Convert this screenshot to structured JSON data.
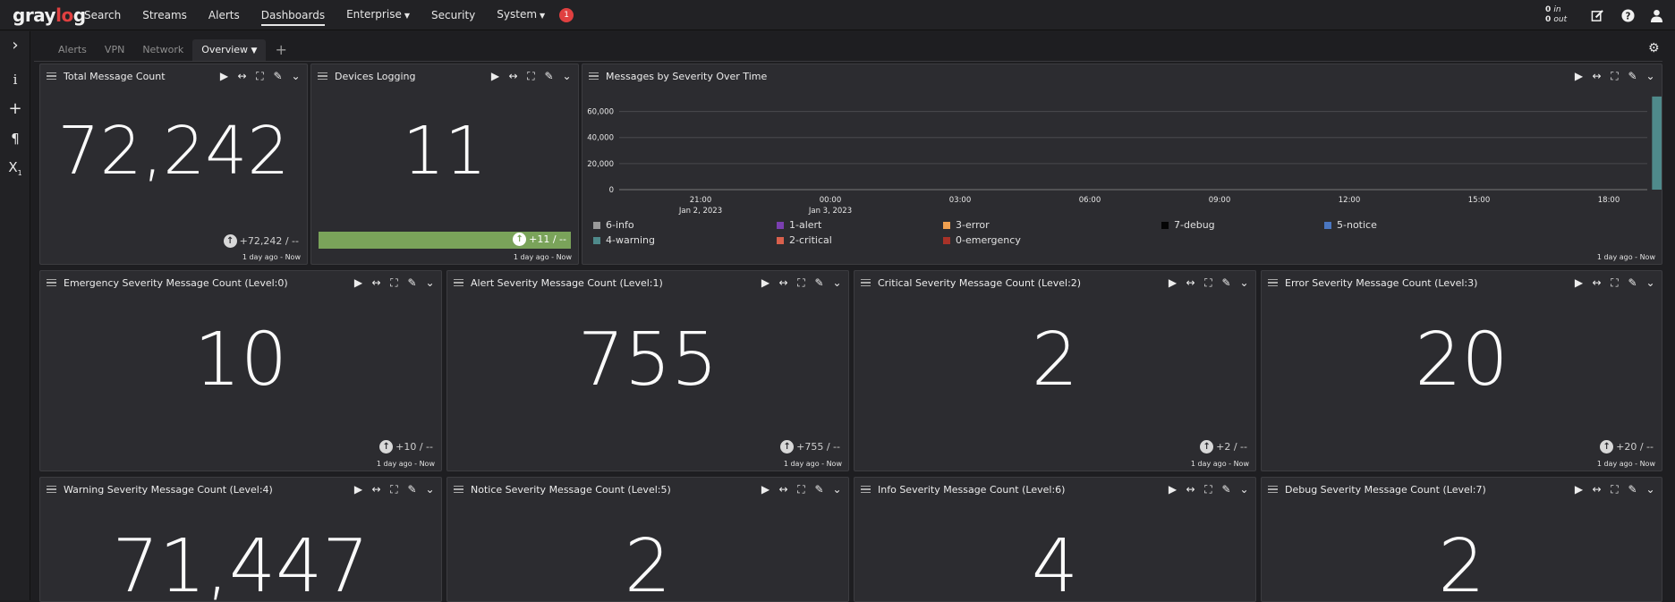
{
  "nav": {
    "logo_pre": "gray",
    "logo_mid": "lo",
    "logo_post": "g",
    "items": [
      "Search",
      "Streams",
      "Alerts",
      "Dashboards",
      "Enterprise",
      "Security",
      "System"
    ],
    "notification_count": "1",
    "throughput_in_value": "0",
    "throughput_in_label": "in",
    "throughput_out_value": "0",
    "throughput_out_label": "out"
  },
  "tabs": [
    "Alerts",
    "VPN",
    "Network",
    "Overview",
    "+"
  ],
  "sidebar_icons": [
    "chevron-right-icon",
    "info-icon",
    "plus-icon",
    "paragraph-icon",
    "subscript-icon"
  ],
  "widgets": {
    "total": {
      "title": "Total Message Count",
      "value": "72,242",
      "delta": "+72,242 / --",
      "stamp": "1 day ago - Now"
    },
    "devices": {
      "title": "Devices Logging",
      "value": "11",
      "delta": "+11 / --",
      "stamp": "1 day ago - Now"
    },
    "chart": {
      "title": "Messages by Severity Over Time",
      "stamp": "1 day ago - Now"
    },
    "emergency": {
      "title": "Emergency Severity Message Count (Level:0)",
      "value": "10",
      "delta": "+10 / --",
      "stamp": "1 day ago - Now"
    },
    "alert": {
      "title": "Alert Severity Message Count (Level:1)",
      "value": "755",
      "delta": "+755 / --",
      "stamp": "1 day ago - Now"
    },
    "critical": {
      "title": "Critical Severity Message Count (Level:2)",
      "value": "2",
      "delta": "+2 / --",
      "stamp": "1 day ago - Now"
    },
    "error": {
      "title": "Error Severity Message Count (Level:3)",
      "value": "20",
      "delta": "+20 / --",
      "stamp": "1 day ago - Now"
    },
    "warning": {
      "title": "Warning Severity Message Count (Level:4)",
      "value": "71,447"
    },
    "notice": {
      "title": "Notice Severity Message Count (Level:5)",
      "value": "2"
    },
    "info": {
      "title": "Info Severity Message Count (Level:6)",
      "value": "4"
    },
    "debug": {
      "title": "Debug Severity Message Count (Level:7)",
      "value": "2"
    }
  },
  "chart_data": {
    "type": "bar",
    "y_ticks": [
      "60,000",
      "40,000",
      "20,000",
      "0"
    ],
    "ylim": [
      0,
      70000
    ],
    "x_ticks": [
      {
        "label": "21:00",
        "sub": "Jan 2, 2023"
      },
      {
        "label": "00:00",
        "sub": "Jan 3, 2023"
      },
      {
        "label": "03:00",
        "sub": ""
      },
      {
        "label": "06:00",
        "sub": ""
      },
      {
        "label": "09:00",
        "sub": ""
      },
      {
        "label": "12:00",
        "sub": ""
      },
      {
        "label": "15:00",
        "sub": ""
      },
      {
        "label": "18:00",
        "sub": ""
      }
    ],
    "series": [
      {
        "name": "4-warning",
        "color": "#4f8a8b",
        "values": [
          {
            "time": "Jan 3, 2023 19:00",
            "count": 71447
          }
        ]
      },
      {
        "name": "2-critical",
        "color": "#d9604c",
        "values": [
          {
            "time": "Jan 3, 2023 20:00",
            "count": 2
          }
        ]
      }
    ],
    "legend": [
      {
        "name": "6-info",
        "color": "#9a9a9a"
      },
      {
        "name": "1-alert",
        "color": "#7a3fb0"
      },
      {
        "name": "3-error",
        "color": "#f0a050"
      },
      {
        "name": "7-debug",
        "color": "#050505"
      },
      {
        "name": "5-notice",
        "color": "#4a76c0"
      },
      {
        "name": "4-warning",
        "color": "#4f8a8b"
      },
      {
        "name": "2-critical",
        "color": "#d9604c"
      },
      {
        "name": "0-emergency",
        "color": "#a83228"
      }
    ]
  }
}
